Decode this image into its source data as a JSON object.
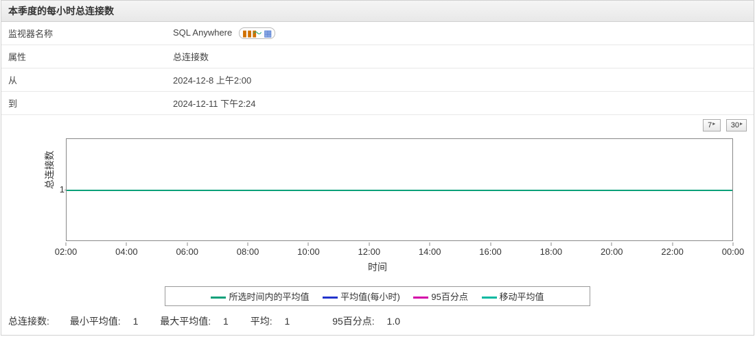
{
  "header": {
    "title": "本季度的每小时总连接数"
  },
  "info": {
    "rows": [
      {
        "label": "监视器名称",
        "value": "SQL Anywhere",
        "has_icons": true
      },
      {
        "label": "属性",
        "value": "总连接数"
      },
      {
        "label": "从",
        "value": "2024-12-8 上午2:00"
      },
      {
        "label": "到",
        "value": "2024-12-11 下午2:24"
      }
    ]
  },
  "time_buttons": [
    {
      "label": "7"
    },
    {
      "label": "30"
    }
  ],
  "legend": [
    {
      "label": "所选时间内的平均值",
      "color": "#0aa079"
    },
    {
      "label": "平均值(每小时)",
      "color": "#2233cc"
    },
    {
      "label": "95百分点",
      "color": "#d400a8"
    },
    {
      "label": "移动平均值",
      "color": "#00b8a0"
    }
  ],
  "stats": {
    "metric_label": "总连接数:",
    "items": [
      {
        "label": "最小平均值:",
        "value": "1"
      },
      {
        "label": "最大平均值:",
        "value": "1"
      },
      {
        "label": "平均:",
        "value": "1"
      },
      {
        "label": "95百分点:",
        "value": "1.0"
      }
    ]
  },
  "chart_data": {
    "type": "line",
    "title": "",
    "xlabel": "时间",
    "ylabel": "总连接数",
    "ylim": [
      0,
      2
    ],
    "y_ticks": [
      1
    ],
    "x_categories": [
      "02:00",
      "04:00",
      "06:00",
      "08:00",
      "10:00",
      "12:00",
      "14:00",
      "16:00",
      "18:00",
      "20:00",
      "22:00",
      "00:00"
    ],
    "series": [
      {
        "name": "所选时间内的平均值",
        "color": "#0aa079",
        "values": [
          1,
          1,
          1,
          1,
          1,
          1,
          1,
          1,
          1,
          1,
          1,
          1
        ]
      },
      {
        "name": "平均值(每小时)",
        "color": "#2233cc",
        "values": [
          1,
          1,
          1,
          1,
          1,
          1,
          1,
          1,
          1,
          1,
          1,
          1
        ]
      },
      {
        "name": "95百分点",
        "color": "#d400a8",
        "values": [
          1,
          1,
          1,
          1,
          1,
          1,
          1,
          1,
          1,
          1,
          1,
          1
        ]
      },
      {
        "name": "移动平均值",
        "color": "#00b8a0",
        "values": [
          1,
          1,
          1,
          1,
          1,
          1,
          1,
          1,
          1,
          1,
          1,
          1
        ]
      }
    ]
  }
}
